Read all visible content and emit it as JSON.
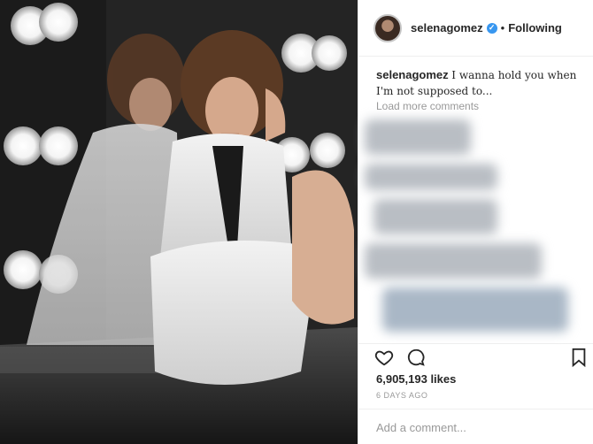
{
  "post": {
    "username": "selenagomez",
    "follow_label": "Following",
    "caption_user": "selenagomez",
    "caption_text": "I wanna hold you when I'm not supposed to...",
    "load_more": "Load more comments",
    "likes": "6,905,193 likes",
    "age": "6 DAYS AGO",
    "comment_placeholder": "Add a comment..."
  },
  "icons": {
    "verified": "verified-badge-icon",
    "like": "heart-icon",
    "comment": "comment-bubble-icon",
    "save": "bookmark-icon"
  },
  "colors": {
    "verified": "#3897f0",
    "text": "#262626",
    "muted": "#999999",
    "border": "#efefef"
  }
}
